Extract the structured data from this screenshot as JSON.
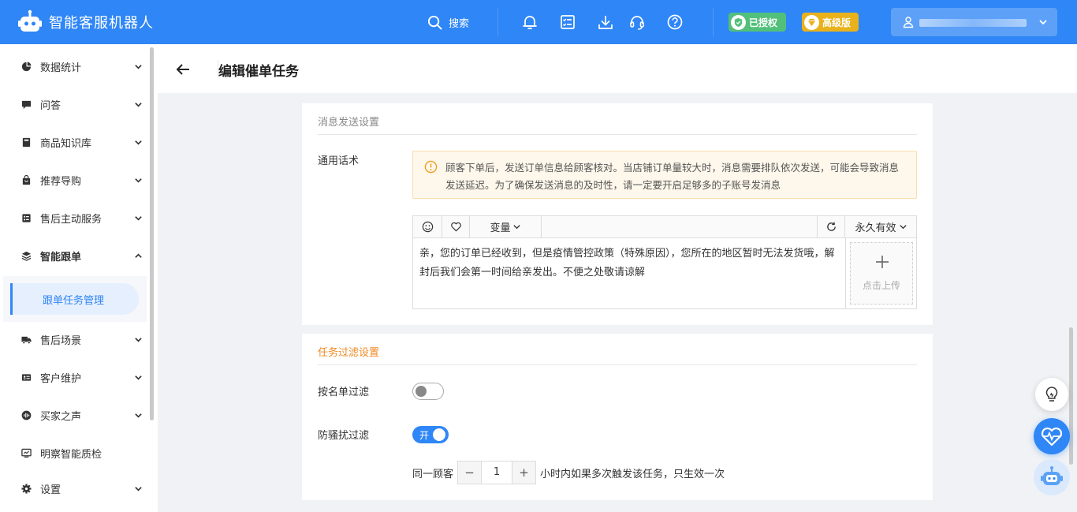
{
  "app": {
    "title": "智能客服机器人"
  },
  "topbar": {
    "search_label": "搜索",
    "auth_badge": "已授权",
    "pro_badge": "高级版"
  },
  "sidebar": {
    "items": [
      {
        "label": "数据统计",
        "icon": "pie-chart-icon",
        "expanded": false
      },
      {
        "label": "问答",
        "icon": "chat-icon",
        "expanded": false
      },
      {
        "label": "商品知识库",
        "icon": "book-icon",
        "expanded": false
      },
      {
        "label": "推荐导购",
        "icon": "bag-icon",
        "expanded": false
      },
      {
        "label": "售后主动服务",
        "icon": "list-icon",
        "expanded": false
      },
      {
        "label": "智能跟单",
        "icon": "layers-icon",
        "expanded": true
      },
      {
        "label": "售后场景",
        "icon": "truck-icon",
        "expanded": false
      },
      {
        "label": "客户维护",
        "icon": "id-card-icon",
        "expanded": false
      },
      {
        "label": "买家之声",
        "icon": "voice-icon",
        "expanded": false
      },
      {
        "label": "明察智能质检",
        "icon": "monitor-icon",
        "expanded": null
      },
      {
        "label": "设置",
        "icon": "gear-icon",
        "expanded": false
      }
    ],
    "active_sub_item": "跟单任务管理"
  },
  "page": {
    "title": "编辑催单任务"
  },
  "message_section": {
    "title": "消息发送设置",
    "label": "通用话术",
    "notice": "顾客下单后，发送订单信息给顾客核对。当店铺订单量较大时，消息需要排队依次发送，可能会导致消息发送延迟。为了确保发送消息的及时性，请一定要开启足够多的子账号发消息",
    "editor": {
      "variable_label": "变量",
      "validity_label": "永久有效",
      "content": "亲，您的订单已经收到，但是疫情管控政策（特殊原因），您所在的地区暂时无法发货哦，解封后我们会第一时间给亲发出。不便之处敬请谅解",
      "upload_label": "点击上传"
    }
  },
  "filter_section": {
    "title": "任务过滤设置",
    "list_filter_label": "按名单过滤",
    "list_filter_on": false,
    "harass_filter_label": "防骚扰过滤",
    "harass_filter_on": true,
    "harass_toggle_text": "开",
    "freq_prefix": "同一顾客",
    "freq_value": "1",
    "freq_suffix": "小时内如果多次触发该任务，只生效一次",
    "minus": "−",
    "plus": "+"
  },
  "colors": {
    "primary": "#2f86f6",
    "auth_green": "#52c07a",
    "pro_gold": "#e9b21b",
    "section_orange": "#f08a24",
    "notice_bg": "#fef7eb"
  }
}
